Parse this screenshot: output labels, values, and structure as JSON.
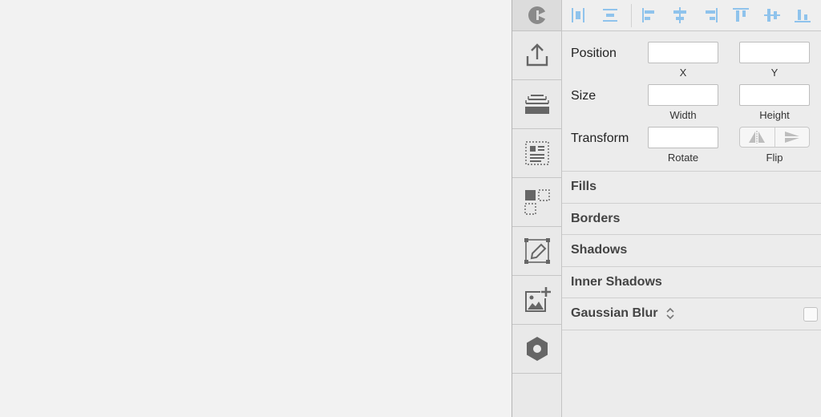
{
  "toolbar": {
    "items": [
      {
        "icon": "export-icon"
      },
      {
        "icon": "layers-stack-icon"
      },
      {
        "icon": "text-layout-icon"
      },
      {
        "icon": "symbol-grid-icon"
      },
      {
        "icon": "edit-shape-icon"
      },
      {
        "icon": "add-image-icon"
      },
      {
        "icon": "settings-hex-icon"
      }
    ]
  },
  "inspector": {
    "geometry": {
      "position_label": "Position",
      "size_label": "Size",
      "transform_label": "Transform",
      "x_caption": "X",
      "y_caption": "Y",
      "width_caption": "Width",
      "height_caption": "Height",
      "rotate_caption": "Rotate",
      "flip_caption": "Flip",
      "x_value": "",
      "y_value": "",
      "width_value": "",
      "height_value": "",
      "rotate_value": ""
    },
    "sections": {
      "fills": "Fills",
      "borders": "Borders",
      "shadows": "Shadows",
      "inner_shadows": "Inner Shadows",
      "blur": "Gaussian Blur"
    }
  },
  "colors": {
    "accent": "#8fc3ec",
    "icon_gray": "#666666"
  }
}
